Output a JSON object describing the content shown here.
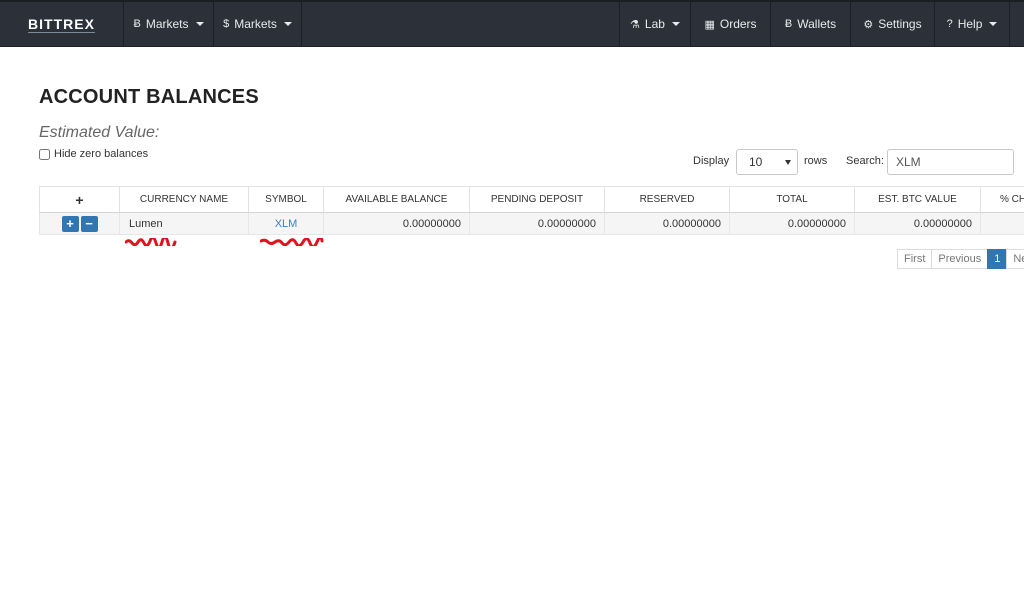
{
  "navbar": {
    "brand": "BITTREX",
    "items": [
      {
        "label": "Markets",
        "icon": "bitcoin-icon",
        "glyph": "Ƀ"
      },
      {
        "label": "Markets",
        "icon": "dollar-icon",
        "glyph": "$"
      },
      {
        "label": "Lab",
        "icon": "flask-icon",
        "glyph": "⚗"
      },
      {
        "label": "Orders",
        "icon": "calendar-icon",
        "glyph": "▦"
      },
      {
        "label": "Wallets",
        "icon": "bitcoin-icon",
        "glyph": "Ƀ"
      },
      {
        "label": "Settings",
        "icon": "gear-icon",
        "glyph": "⚙"
      },
      {
        "label": "Help",
        "icon": "question-circle-icon",
        "glyph": "?"
      }
    ]
  },
  "page": {
    "title": "ACCOUNT BALANCES",
    "estimated_label": "Estimated Value:",
    "hide_zero_label": "Hide zero balances"
  },
  "controls": {
    "display_label": "Display",
    "display_value": "10",
    "rows_label": "rows",
    "search_label": "Search:",
    "search_value": "XLM"
  },
  "table": {
    "headers": [
      "+",
      "CURRENCY NAME",
      "SYMBOL",
      "AVAILABLE BALANCE",
      "PENDING DEPOSIT",
      "RESERVED",
      "TOTAL",
      "EST. BTC VALUE",
      "% CHANGE"
    ],
    "rows": [
      {
        "currency_name": "Lumen",
        "symbol": "XLM",
        "available_balance": "0.00000000",
        "pending_deposit": "0.00000000",
        "reserved": "0.00000000",
        "total": "0.00000000",
        "est_btc_value": "0.00000000",
        "pct_change": ""
      }
    ]
  },
  "pagination": {
    "first": "First",
    "previous": "Previous",
    "current": "1",
    "next": "Next"
  },
  "colors": {
    "navbar": "#2b3039",
    "accent": "#3276b1",
    "link": "#3d7fc1",
    "redaction": "#e0141e"
  }
}
